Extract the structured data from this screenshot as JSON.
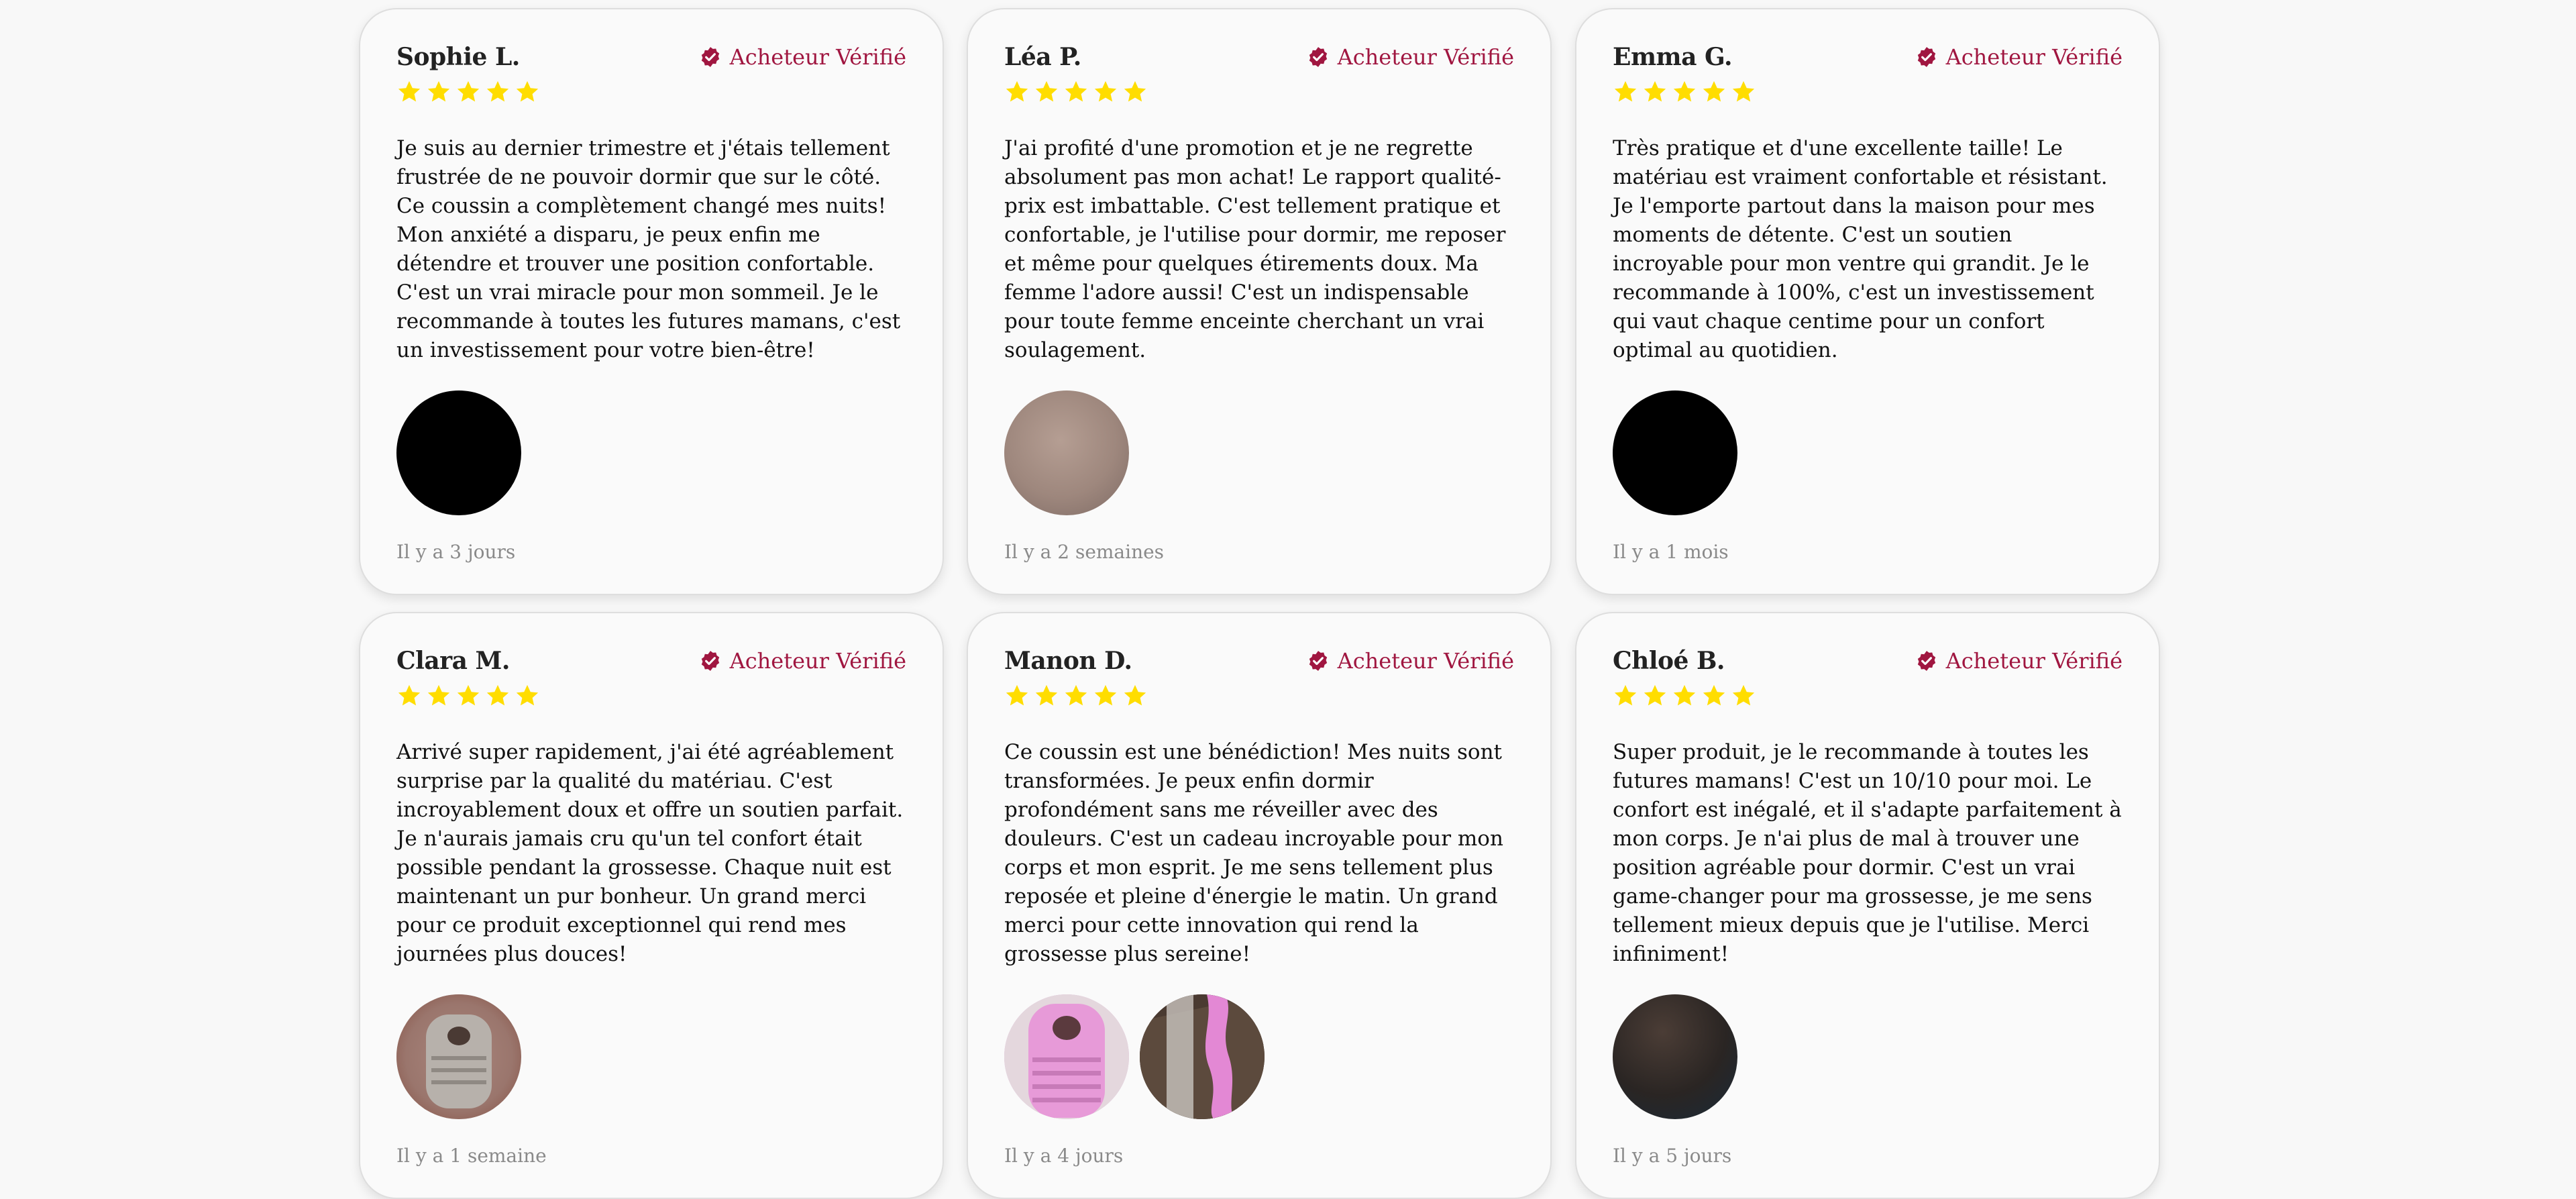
{
  "verified_label": "Acheteur Vérifié",
  "colors": {
    "accent": "#a01640",
    "star": "#ffdd00",
    "card_border": "#dedede",
    "background": "#f8f8f8"
  },
  "reviews": [
    {
      "author": "Sophie L.",
      "rating": 5,
      "text": "Je suis au dernier trimestre et j'étais tellement frustrée de ne pouvoir dormir que sur le côté. Ce coussin a complètement changé mes nuits! Mon anxiété a disparu, je peux enfin me détendre et trouver une position confortable. C'est un vrai miracle pour mon sommeil. Je le recommande à toutes les futures mamans, c'est un investissement pour votre bien-être!",
      "time": "Il y a 3 jours"
    },
    {
      "author": "Léa P.",
      "rating": 5,
      "text": "J'ai profité d'une promotion et je ne regrette absolument pas mon achat! Le rapport qualité-prix est imbattable. C'est tellement pratique et confortable, je l'utilise pour dormir, me reposer et même pour quelques étirements doux. Ma femme l'adore aussi! C'est un indispensable pour toute femme enceinte cherchant un vrai soulagement.",
      "time": "Il y a 2 semaines"
    },
    {
      "author": "Emma G.",
      "rating": 5,
      "text": "Très pratique et d'une excellente taille! Le matériau est vraiment confortable et résistant. Je l'emporte partout dans la maison pour mes moments de détente. C'est un soutien incroyable pour mon ventre qui grandit. Je le recommande à 100%, c'est un investissement qui vaut chaque centime pour un confort optimal au quotidien.",
      "time": "Il y a 1 mois"
    },
    {
      "author": "Clara M.",
      "rating": 5,
      "text": "Arrivé super rapidement, j'ai été agréablement surprise par la qualité du matériau. C'est incroyablement doux et offre un soutien parfait. Je n'aurais jamais cru qu'un tel confort était possible pendant la grossesse. Chaque nuit est maintenant un pur bonheur. Un grand merci pour ce produit exceptionnel qui rend mes journées plus douces!",
      "time": "Il y a 1 semaine"
    },
    {
      "author": "Manon D.",
      "rating": 5,
      "text": "Ce coussin est une bénédiction! Mes nuits sont transformées. Je peux enfin dormir profondément sans me réveiller avec des douleurs. C'est un cadeau incroyable pour mon corps et mon esprit. Je me sens tellement plus reposée et pleine d'énergie le matin. Un grand merci pour cette innovation qui rend la grossesse plus sereine!",
      "time": "Il y a 4 jours"
    },
    {
      "author": "Chloé B.",
      "rating": 5,
      "text": "Super produit, je le recommande à toutes les futures mamans! C'est un 10/10 pour moi. Le confort est inégalé, et il s'adapte parfaitement à mon corps. Je n'ai plus de mal à trouver une position agréable pour dormir. C'est un vrai game-changer pour ma grossesse, je me sens tellement mieux depuis que je l'utilise. Merci infiniment!",
      "time": "Il y a 5 jours"
    }
  ]
}
